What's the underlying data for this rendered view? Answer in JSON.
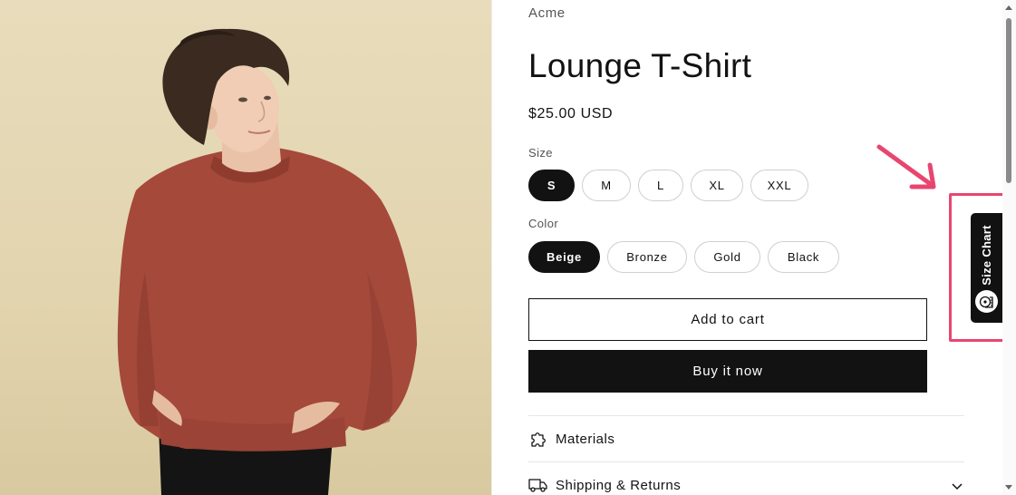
{
  "product": {
    "vendor": "Acme",
    "title": "Lounge T-Shirt",
    "price": "$25.00 USD",
    "image_alt": "man-in-rust-sweatshirt-photo"
  },
  "options": {
    "size": {
      "label": "Size",
      "selected": "S",
      "values": [
        "S",
        "M",
        "L",
        "XL",
        "XXL"
      ]
    },
    "color": {
      "label": "Color",
      "selected": "Beige",
      "values": [
        "Beige",
        "Bronze",
        "Gold",
        "Black"
      ]
    }
  },
  "actions": {
    "add_to_cart": "Add to cart",
    "buy_now": "Buy it now"
  },
  "accordions": [
    {
      "label": "Materials",
      "icon": "puzzle-icon"
    },
    {
      "label": "Shipping & Returns",
      "icon": "truck-icon"
    }
  ],
  "size_chart_tab": {
    "label": "Size Chart",
    "icon": "tape-measure-icon"
  },
  "colors": {
    "accent_dark": "#121212",
    "annotation": "#e8466f",
    "photo_background": "#e5d8b4",
    "sweatshirt": "#a5493a"
  }
}
